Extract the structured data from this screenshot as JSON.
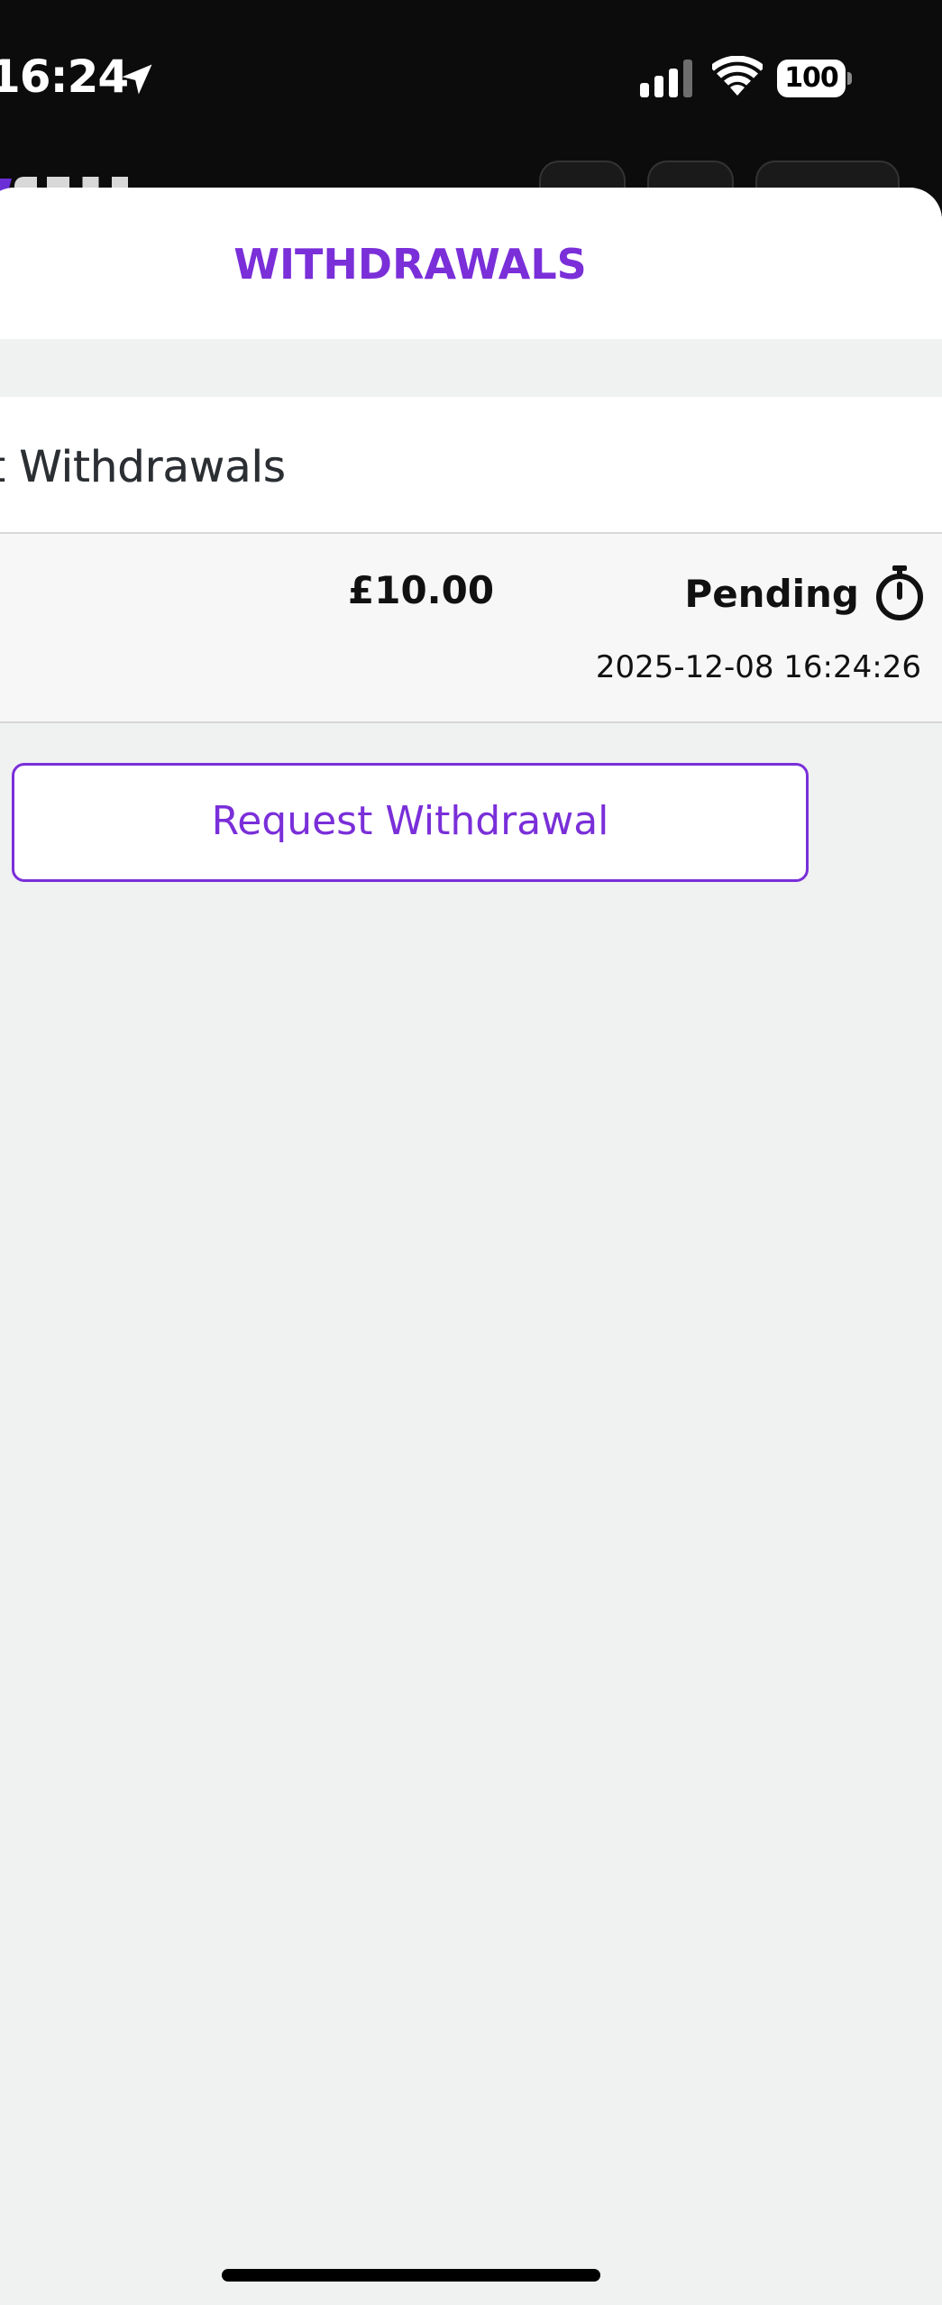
{
  "status_bar": {
    "time": "16:24",
    "battery": "100",
    "icons": [
      "location-arrow-icon",
      "cellular-signal-icon",
      "wifi-icon",
      "battery-icon"
    ]
  },
  "sheet": {
    "title": "WITHDRAWALS"
  },
  "recent": {
    "section_title": "Recent Withdrawals",
    "items": [
      {
        "amount": "£10.00",
        "status": "Pending",
        "status_icon": "stopwatch-icon",
        "timestamp": "2025-12-08 16:24:26"
      }
    ]
  },
  "actions": {
    "request_label": "Request Withdrawal"
  },
  "colors": {
    "accent": "#7a2fd9",
    "sheet_background": "#f0f1f1",
    "status_bar_background": "#0c0c0c"
  }
}
